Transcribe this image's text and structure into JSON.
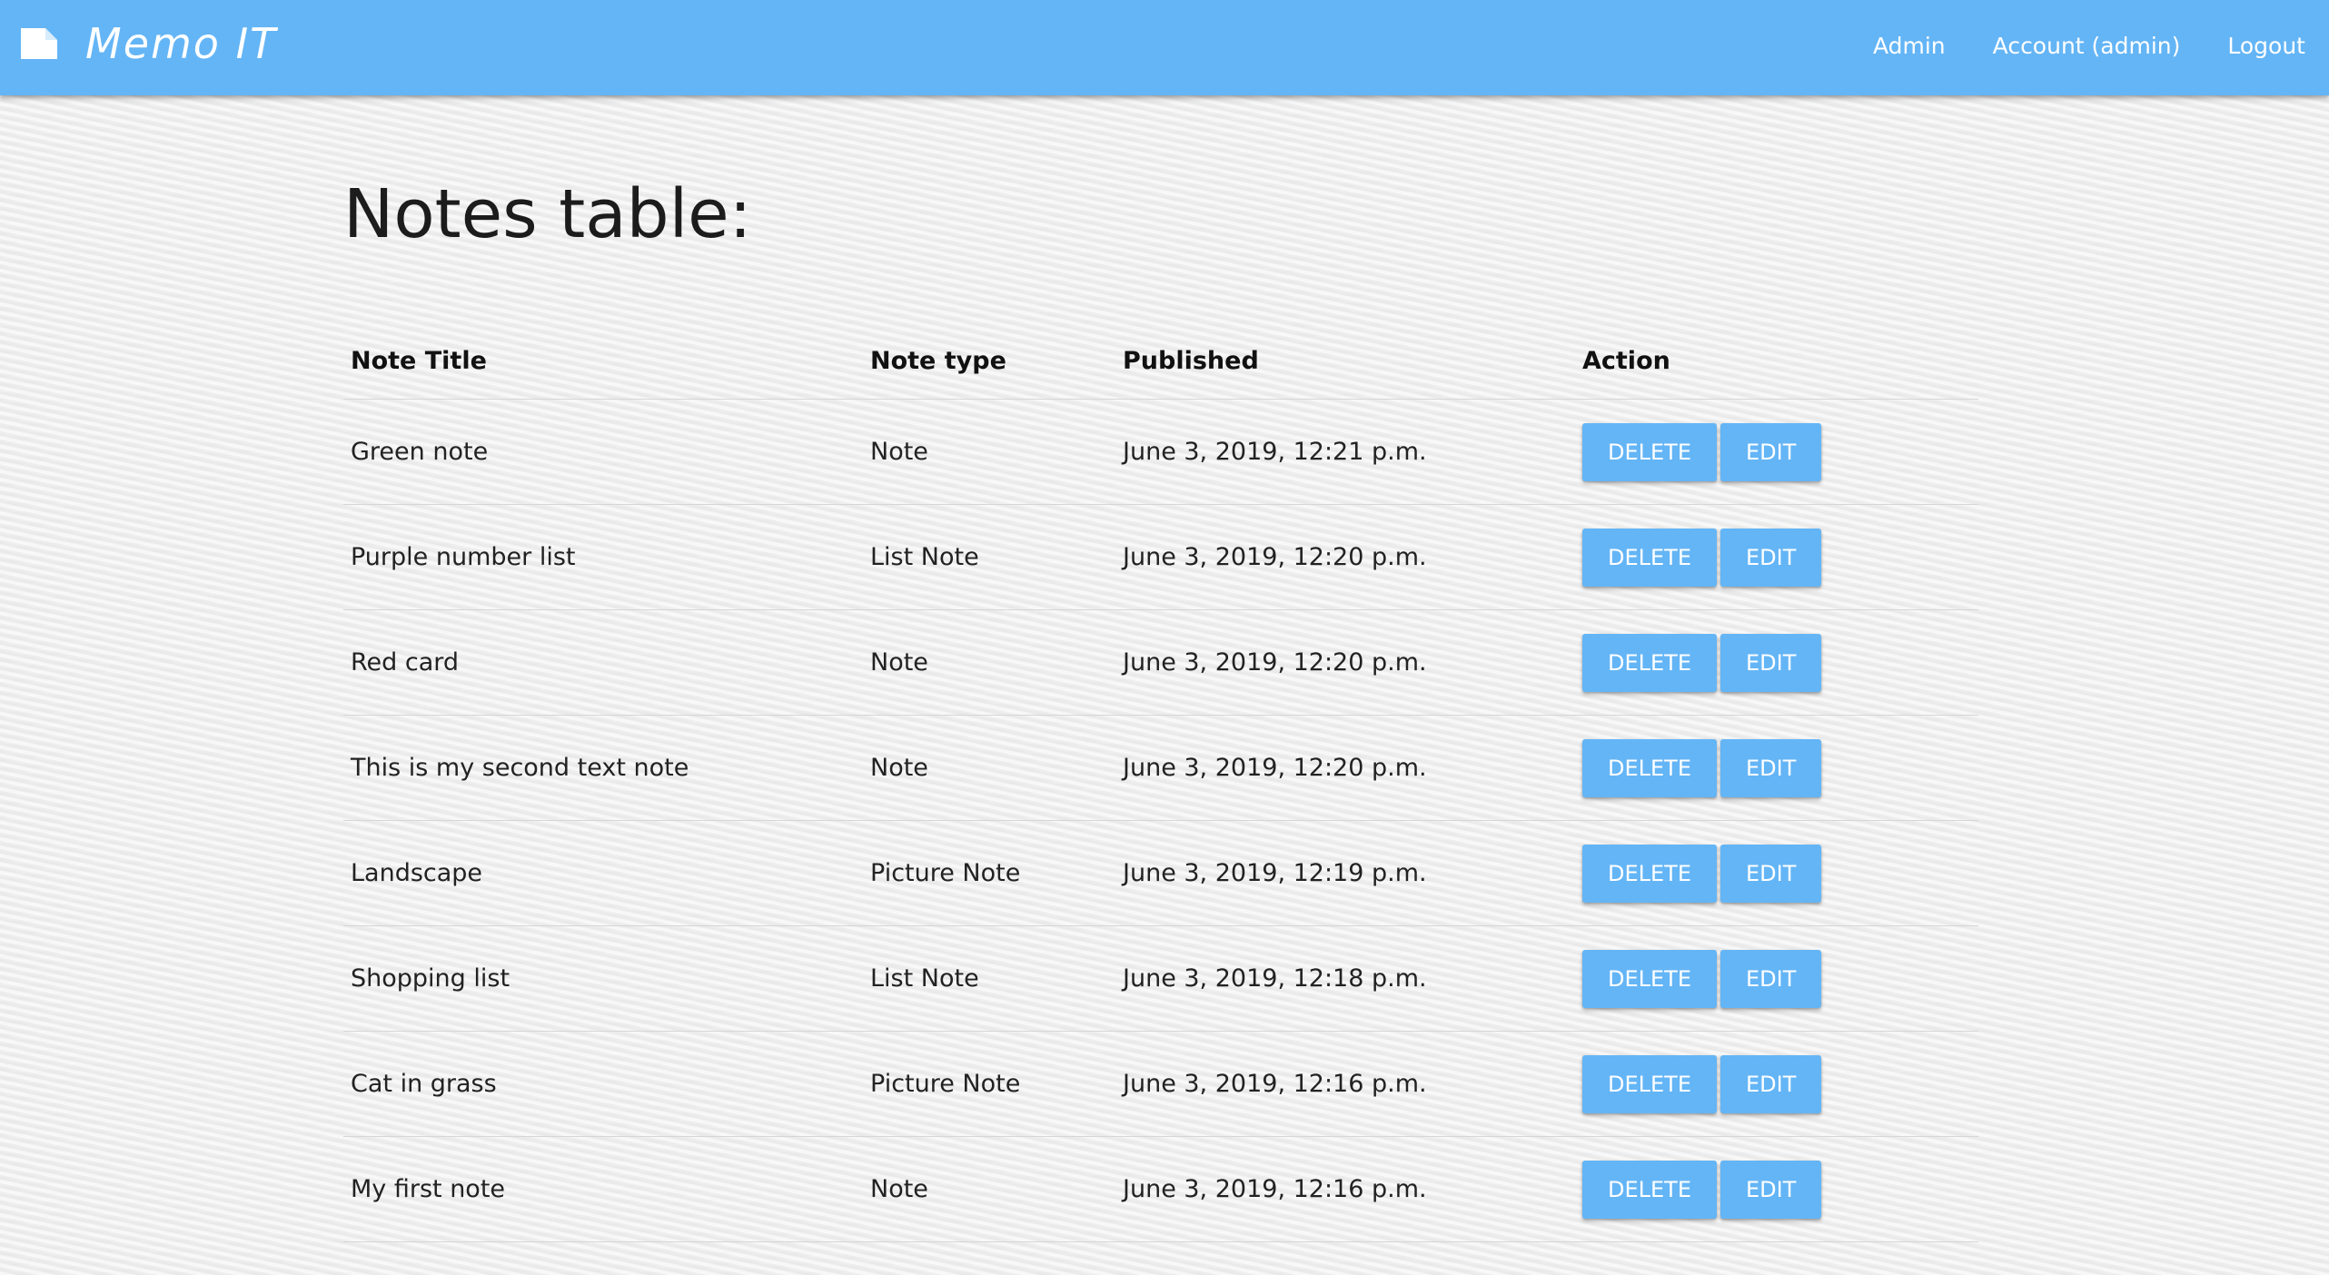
{
  "navbar": {
    "brand": "Memo IT",
    "brand_icon": "note-icon",
    "links": [
      "Admin",
      "Account (admin)",
      "Logout"
    ],
    "accent_color": "#64b5f6"
  },
  "page": {
    "title": "Notes table:"
  },
  "table": {
    "headers": [
      "Note Title",
      "Note type",
      "Published",
      "Action"
    ],
    "rows": [
      {
        "title": "Green note",
        "type": "Note",
        "published": "June 3, 2019, 12:21 p.m.",
        "delete": "DELETE",
        "edit": "EDIT"
      },
      {
        "title": "Purple number list",
        "type": "List Note",
        "published": "June 3, 2019, 12:20 p.m.",
        "delete": "DELETE",
        "edit": "EDIT"
      },
      {
        "title": "Red card",
        "type": "Note",
        "published": "June 3, 2019, 12:20 p.m.",
        "delete": "DELETE",
        "edit": "EDIT"
      },
      {
        "title": "This is my second text note",
        "type": "Note",
        "published": "June 3, 2019, 12:20 p.m.",
        "delete": "DELETE",
        "edit": "EDIT"
      },
      {
        "title": "Landscape",
        "type": "Picture Note",
        "published": "June 3, 2019, 12:19 p.m.",
        "delete": "DELETE",
        "edit": "EDIT"
      },
      {
        "title": "Shopping list",
        "type": "List Note",
        "published": "June 3, 2019, 12:18 p.m.",
        "delete": "DELETE",
        "edit": "EDIT"
      },
      {
        "title": "Cat in grass",
        "type": "Picture Note",
        "published": "June 3, 2019, 12:16 p.m.",
        "delete": "DELETE",
        "edit": "EDIT"
      },
      {
        "title": "My first note",
        "type": "Note",
        "published": "June 3, 2019, 12:16 p.m.",
        "delete": "DELETE",
        "edit": "EDIT"
      }
    ]
  }
}
